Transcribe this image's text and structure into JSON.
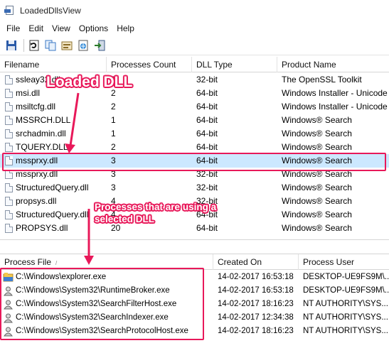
{
  "window": {
    "title": "LoadedDllsView"
  },
  "menu": [
    "File",
    "Edit",
    "View",
    "Options",
    "Help"
  ],
  "toolbar": {
    "buttons": [
      {
        "icon": "save-icon"
      },
      {
        "icon": "refresh-icon"
      },
      {
        "icon": "copy-icon"
      },
      {
        "icon": "properties-icon"
      },
      {
        "icon": "html-report-icon"
      },
      {
        "icon": "exit-icon"
      }
    ]
  },
  "dll_table": {
    "columns": [
      "Filename",
      "Processes Count",
      "DLL Type",
      "Product Name"
    ],
    "rows": [
      {
        "filename": "ssleay32.dll",
        "count": "1",
        "type": "32-bit",
        "product": "The OpenSSL Toolkit"
      },
      {
        "filename": "msi.dll",
        "count": "2",
        "type": "64-bit",
        "product": "Windows Installer - Unicode"
      },
      {
        "filename": "msiltcfg.dll",
        "count": "2",
        "type": "64-bit",
        "product": "Windows Installer - Unicode"
      },
      {
        "filename": "MSSRCH.DLL",
        "count": "1",
        "type": "64-bit",
        "product": "Windows® Search"
      },
      {
        "filename": "srchadmin.dll",
        "count": "1",
        "type": "64-bit",
        "product": "Windows® Search"
      },
      {
        "filename": "TQUERY.DLL",
        "count": "2",
        "type": "64-bit",
        "product": "Windows® Search"
      },
      {
        "filename": "mssprxy.dll",
        "count": "3",
        "type": "64-bit",
        "product": "Windows® Search"
      },
      {
        "filename": "mssprxy.dll",
        "count": "3",
        "type": "32-bit",
        "product": "Windows® Search"
      },
      {
        "filename": "StructuredQuery.dll",
        "count": "3",
        "type": "32-bit",
        "product": "Windows® Search"
      },
      {
        "filename": "propsys.dll",
        "count": "4",
        "type": "32-bit",
        "product": "Windows® Search"
      },
      {
        "filename": "StructuredQuery.dll",
        "count": "4",
        "type": "64-bit",
        "product": "Windows® Search"
      },
      {
        "filename": "PROPSYS.dll",
        "count": "20",
        "type": "64-bit",
        "product": "Windows® Search"
      }
    ],
    "selected_index": 6
  },
  "process_table": {
    "columns": [
      "Process File",
      "Created On",
      "Process User"
    ],
    "rows": [
      {
        "file": "C:\\Windows\\explorer.exe",
        "created": "14-02-2017 16:53:18",
        "user": "DESKTOP-UE9FS9M\\...",
        "icon": "explorer-icon"
      },
      {
        "file": "C:\\Windows\\System32\\RuntimeBroker.exe",
        "created": "14-02-2017 16:53:18",
        "user": "DESKTOP-UE9FS9M\\...",
        "icon": "user-process-icon"
      },
      {
        "file": "C:\\Windows\\System32\\SearchFilterHost.exe",
        "created": "14-02-2017 18:16:23",
        "user": "NT AUTHORITY\\SYS...",
        "icon": "user-process-icon"
      },
      {
        "file": "C:\\Windows\\System32\\SearchIndexer.exe",
        "created": "14-02-2017 12:34:38",
        "user": "NT AUTHORITY\\SYS...",
        "icon": "user-process-icon"
      },
      {
        "file": "C:\\Windows\\System32\\SearchProtocolHost.exe",
        "created": "14-02-2017 18:16:23",
        "user": "NT AUTHORITY\\SYS...",
        "icon": "user-process-icon"
      }
    ]
  },
  "annotations": {
    "loaded_dll": "Loaded DLL",
    "processes_line1": "Processes that are using a",
    "processes_line2": "selected DLL",
    "color": "#e8195a"
  }
}
